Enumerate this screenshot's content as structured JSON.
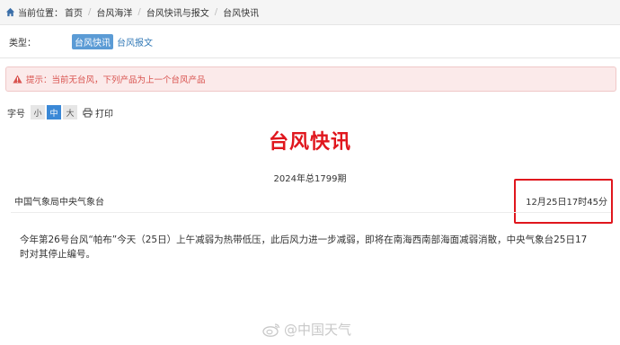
{
  "breadcrumb": {
    "prefix": "当前位置：",
    "items": [
      "首页",
      "台风海洋",
      "台风快讯与报文",
      "台风快讯"
    ]
  },
  "type_filter": {
    "label": "类型：",
    "active": "台风快讯",
    "other": "台风报文"
  },
  "alert": {
    "text": "提示：当前无台风，下列产品为上一个台风产品"
  },
  "font_size": {
    "label": "字号",
    "options": [
      "小",
      "中",
      "大"
    ],
    "selected": "中",
    "print_label": "打印"
  },
  "document": {
    "title": "台风快讯",
    "issue": "2024年总1799期",
    "issuer": "中国气象局中央气象台",
    "time": "12月25日17时45分",
    "body": "今年第26号台风“帕布”今天（25日）上午减弱为热带低压，此后风力进一步减弱，即将在南海西南部海面减弱消散，中央气象台25日17时对其停止编号。"
  },
  "watermark": {
    "text": "@中国天气"
  },
  "colors": {
    "title_red": "#e0161d",
    "accent_blue": "#3a88d6",
    "alert_red": "#d9534f"
  }
}
